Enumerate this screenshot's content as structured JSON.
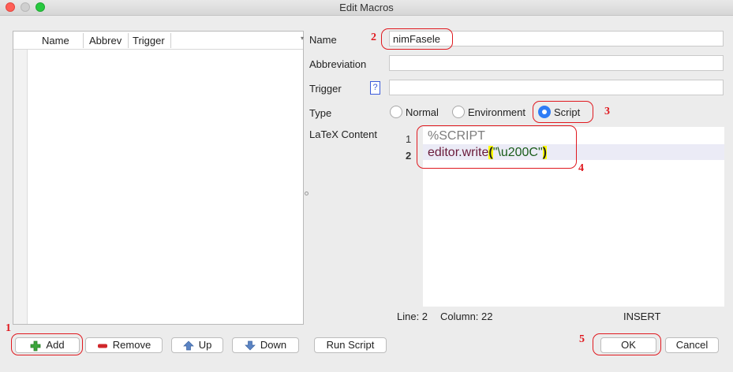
{
  "window": {
    "title": "Edit Macros"
  },
  "list": {
    "columns": [
      "Name",
      "Abbrev",
      "Trigger"
    ],
    "rows": []
  },
  "form": {
    "name_label": "Name",
    "name_value": "nimFasele",
    "abbreviation_label": "Abbreviation",
    "abbreviation_value": "",
    "trigger_label": "Trigger",
    "trigger_help": "?",
    "trigger_value": "",
    "type_label": "Type",
    "type_options": [
      {
        "label": "Normal",
        "selected": false
      },
      {
        "label": "Environment",
        "selected": false
      },
      {
        "label": "Script",
        "selected": true
      }
    ],
    "content_label": "LaTeX Content"
  },
  "editor": {
    "lines": [
      {
        "number": "1",
        "text": "%SCRIPT"
      },
      {
        "number": "2",
        "obj": "editor",
        "dot": ".",
        "method": "write",
        "open": "(",
        "string": "\"\\u200C\"",
        "close": ")"
      }
    ],
    "status_line": "Line: 2",
    "status_column": "Column: 22",
    "status_mode": "INSERT"
  },
  "buttons": {
    "add": "Add",
    "remove": "Remove",
    "up": "Up",
    "down": "Down",
    "run_script": "Run Script",
    "ok": "OK",
    "cancel": "Cancel"
  },
  "annotations": [
    "1",
    "2",
    "3",
    "4",
    "5"
  ],
  "colors": {
    "accent": "#2e7cf6",
    "annotation": "#e0191f",
    "add_icon": "#3aa53a",
    "remove_icon": "#d0262a",
    "arrow_icon": "#5b84c4"
  }
}
